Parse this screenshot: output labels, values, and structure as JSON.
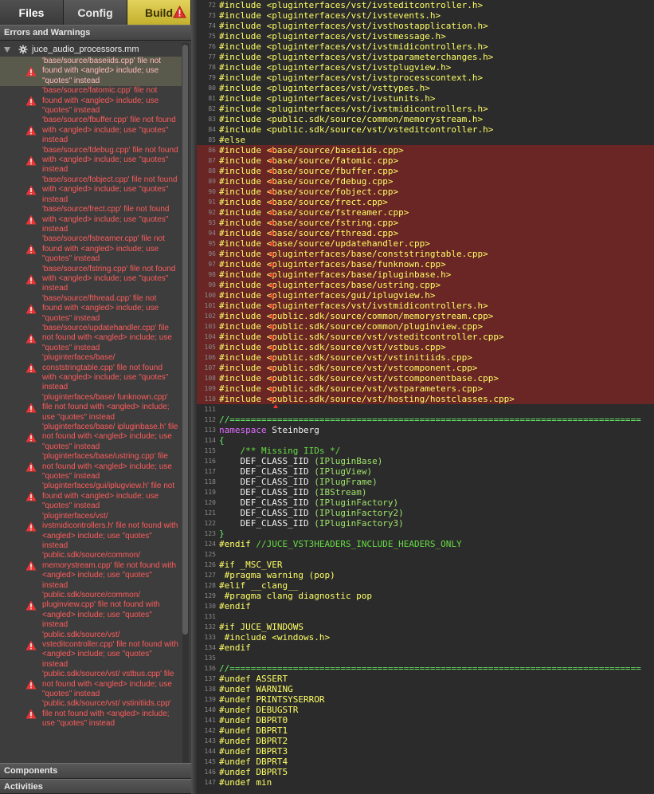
{
  "tabs": {
    "files": "Files",
    "config": "Config",
    "build": "Build"
  },
  "panel": {
    "errors_header": "Errors and Warnings",
    "project_file": "juce_audio_processors.mm",
    "components": "Components",
    "activities": "Activities"
  },
  "errors": [
    {
      "text": "'base/source/baseiids.cpp' file not found with <angled> include; use \"quotes\" instead",
      "selected": true
    },
    {
      "text": "'base/source/fatomic.cpp' file not found with <angled> include; use \"quotes\" instead"
    },
    {
      "text": "'base/source/fbuffer.cpp' file not found with <angled> include; use \"quotes\" instead"
    },
    {
      "text": "'base/source/fdebug.cpp' file not found with <angled> include; use \"quotes\" instead"
    },
    {
      "text": "'base/source/fobject.cpp' file not found with <angled> include; use \"quotes\" instead"
    },
    {
      "text": "'base/source/frect.cpp' file not found with <angled> include; use \"quotes\" instead"
    },
    {
      "text": "'base/source/fstreamer.cpp' file not found with <angled> include; use \"quotes\" instead"
    },
    {
      "text": "'base/source/fstring.cpp' file not found with <angled> include; use \"quotes\" instead"
    },
    {
      "text": "'base/source/fthread.cpp' file not found with <angled> include; use \"quotes\" instead"
    },
    {
      "text": "'base/source/updatehandler.cpp' file not found with <angled> include; use \"quotes\" instead"
    },
    {
      "text": "'pluginterfaces/base/ conststringtable.cpp' file not found with <angled> include; use \"quotes\" instead"
    },
    {
      "text": "'pluginterfaces/base/ funknown.cpp' file not found with <angled> include; use \"quotes\" instead"
    },
    {
      "text": "'pluginterfaces/base/ ipluginbase.h' file not found with <angled> include; use \"quotes\" instead"
    },
    {
      "text": "'pluginterfaces/base/ustring.cpp' file not found with <angled> include; use \"quotes\" instead"
    },
    {
      "text": "'pluginterfaces/gui/iplugview.h' file not found with <angled> include; use \"quotes\" instead"
    },
    {
      "text": "'pluginterfaces/vst/ ivstmidicontrollers.h' file not found with <angled> include; use \"quotes\" instead"
    },
    {
      "text": "'public.sdk/source/common/ memorystream.cpp' file not found with <angled> include; use \"quotes\" instead"
    },
    {
      "text": "'public.sdk/source/common/ pluginview.cpp' file not found with <angled> include; use \"quotes\" instead"
    },
    {
      "text": "'public.sdk/source/vst/ vsteditcontroller.cpp' file not found with <angled> include; use \"quotes\" instead"
    },
    {
      "text": "'public.sdk/source/vst/ vstbus.cpp' file not found with <angled> include; use \"quotes\" instead"
    },
    {
      "text": "'public.sdk/source/vst/ vstinitiids.cpp' file not found with <angled> include; use \"quotes\" instead"
    }
  ],
  "code_lines": [
    {
      "n": "72",
      "t": "#include <pluginterfaces/vst/ivsteditcontroller.h>",
      "k": "pp"
    },
    {
      "n": "73",
      "t": "#include <pluginterfaces/vst/ivstevents.h>",
      "k": "pp"
    },
    {
      "n": "74",
      "t": "#include <pluginterfaces/vst/ivsthostapplication.h>",
      "k": "pp"
    },
    {
      "n": "75",
      "t": "#include <pluginterfaces/vst/ivstmessage.h>",
      "k": "pp"
    },
    {
      "n": "76",
      "t": "#include <pluginterfaces/vst/ivstmidicontrollers.h>",
      "k": "pp"
    },
    {
      "n": "77",
      "t": "#include <pluginterfaces/vst/ivstparameterchanges.h>",
      "k": "pp"
    },
    {
      "n": "78",
      "t": "#include <pluginterfaces/vst/ivstplugview.h>",
      "k": "pp"
    },
    {
      "n": "79",
      "t": "#include <pluginterfaces/vst/ivstprocesscontext.h>",
      "k": "pp"
    },
    {
      "n": "80",
      "t": "#include <pluginterfaces/vst/vsttypes.h>",
      "k": "pp"
    },
    {
      "n": "81",
      "t": "#include <pluginterfaces/vst/ivstunits.h>",
      "k": "pp"
    },
    {
      "n": "82",
      "t": "#include <pluginterfaces/vst/ivstmidicontrollers.h>",
      "k": "pp"
    },
    {
      "n": "83",
      "t": "#include <public.sdk/source/common/memorystream.h>",
      "k": "pp"
    },
    {
      "n": "84",
      "t": "#include <public.sdk/source/vst/vsteditcontroller.h>",
      "k": "pp"
    },
    {
      "n": "85",
      "t": "#else",
      "k": "pp"
    },
    {
      "n": "86",
      "t": "#include <base/source/baseiids.cpp>",
      "k": "pp",
      "e": true
    },
    {
      "n": "87",
      "t": "#include <base/source/fatomic.cpp>",
      "k": "pp",
      "e": true
    },
    {
      "n": "88",
      "t": "#include <base/source/fbuffer.cpp>",
      "k": "pp",
      "e": true
    },
    {
      "n": "89",
      "t": "#include <base/source/fdebug.cpp>",
      "k": "pp",
      "e": true
    },
    {
      "n": "90",
      "t": "#include <base/source/fobject.cpp>",
      "k": "pp",
      "e": true
    },
    {
      "n": "91",
      "t": "#include <base/source/frect.cpp>",
      "k": "pp",
      "e": true
    },
    {
      "n": "92",
      "t": "#include <base/source/fstreamer.cpp>",
      "k": "pp",
      "e": true
    },
    {
      "n": "93",
      "t": "#include <base/source/fstring.cpp>",
      "k": "pp",
      "e": true
    },
    {
      "n": "94",
      "t": "#include <base/source/fthread.cpp>",
      "k": "pp",
      "e": true
    },
    {
      "n": "95",
      "t": "#include <base/source/updatehandler.cpp>",
      "k": "pp",
      "e": true
    },
    {
      "n": "96",
      "t": "#include <pluginterfaces/base/conststringtable.cpp>",
      "k": "pp",
      "e": true
    },
    {
      "n": "97",
      "t": "#include <pluginterfaces/base/funknown.cpp>",
      "k": "pp",
      "e": true
    },
    {
      "n": "98",
      "t": "#include <pluginterfaces/base/ipluginbase.h>",
      "k": "pp",
      "e": true
    },
    {
      "n": "99",
      "t": "#include <pluginterfaces/base/ustring.cpp>",
      "k": "pp",
      "e": true
    },
    {
      "n": "100",
      "t": "#include <pluginterfaces/gui/iplugview.h>",
      "k": "pp",
      "e": true
    },
    {
      "n": "101",
      "t": "#include <pluginterfaces/vst/ivstmidicontrollers.h>",
      "k": "pp",
      "e": true
    },
    {
      "n": "102",
      "t": "#include <public.sdk/source/common/memorystream.cpp>",
      "k": "pp",
      "e": true
    },
    {
      "n": "103",
      "t": "#include <public.sdk/source/common/pluginview.cpp>",
      "k": "pp",
      "e": true
    },
    {
      "n": "104",
      "t": "#include <public.sdk/source/vst/vsteditcontroller.cpp>",
      "k": "pp",
      "e": true
    },
    {
      "n": "105",
      "t": "#include <public.sdk/source/vst/vstbus.cpp>",
      "k": "pp",
      "e": true
    },
    {
      "n": "106",
      "t": "#include <public.sdk/source/vst/vstinitiids.cpp>",
      "k": "pp",
      "e": true
    },
    {
      "n": "107",
      "t": "#include <public.sdk/source/vst/vstcomponent.cpp>",
      "k": "pp",
      "e": true
    },
    {
      "n": "108",
      "t": "#include <public.sdk/source/vst/vstcomponentbase.cpp>",
      "k": "pp",
      "e": true
    },
    {
      "n": "109",
      "t": "#include <public.sdk/source/vst/vstparameters.cpp>",
      "k": "pp",
      "e": true
    },
    {
      "n": "110",
      "t": "#include <public.sdk/source/vst/hosting/hostclasses.cpp>",
      "k": "pp",
      "e": true
    },
    {
      "n": "111",
      "t": "",
      "k": "text"
    },
    {
      "n": "112",
      "t": "//==============================================================================",
      "k": "sep"
    },
    {
      "n": "113",
      "t": "namespace Steinberg",
      "k": "text"
    },
    {
      "n": "114",
      "t": "{",
      "k": "sep"
    },
    {
      "n": "115",
      "t": "    /** Missing IIDs */",
      "k": "comment"
    },
    {
      "n": "116",
      "t": "    DEF_CLASS_IID (IPluginBase)",
      "k": "text"
    },
    {
      "n": "117",
      "t": "    DEF_CLASS_IID (IPlugView)",
      "k": "text"
    },
    {
      "n": "118",
      "t": "    DEF_CLASS_IID (IPlugFrame)",
      "k": "text"
    },
    {
      "n": "119",
      "t": "    DEF_CLASS_IID (IBStream)",
      "k": "text"
    },
    {
      "n": "120",
      "t": "    DEF_CLASS_IID (IPluginFactory)",
      "k": "text"
    },
    {
      "n": "121",
      "t": "    DEF_CLASS_IID (IPluginFactory2)",
      "k": "text"
    },
    {
      "n": "122",
      "t": "    DEF_CLASS_IID (IPluginFactory3)",
      "k": "text"
    },
    {
      "n": "123",
      "t": "}",
      "k": "sep"
    },
    {
      "n": "124",
      "t": "#endif //JUCE_VST3HEADERS_INCLUDE_HEADERS_ONLY",
      "k": "endifc"
    },
    {
      "n": "125",
      "t": "",
      "k": "text"
    },
    {
      "n": "126",
      "t": "#if _MSC_VER",
      "k": "pp"
    },
    {
      "n": "127",
      "t": " #pragma warning (pop)",
      "k": "pp"
    },
    {
      "n": "128",
      "t": "#elif __clang__",
      "k": "pp"
    },
    {
      "n": "129",
      "t": " #pragma clang diagnostic pop",
      "k": "pp"
    },
    {
      "n": "130",
      "t": "#endif",
      "k": "pp"
    },
    {
      "n": "131",
      "t": "",
      "k": "text"
    },
    {
      "n": "132",
      "t": "#if JUCE_WINDOWS",
      "k": "pp"
    },
    {
      "n": "133",
      "t": " #include <windows.h>",
      "k": "pp"
    },
    {
      "n": "134",
      "t": "#endif",
      "k": "pp"
    },
    {
      "n": "135",
      "t": "",
      "k": "text"
    },
    {
      "n": "136",
      "t": "//==============================================================================",
      "k": "sep"
    },
    {
      "n": "137",
      "t": "#undef ASSERT",
      "k": "pp"
    },
    {
      "n": "138",
      "t": "#undef WARNING",
      "k": "pp"
    },
    {
      "n": "139",
      "t": "#undef PRINTSYSERROR",
      "k": "pp"
    },
    {
      "n": "140",
      "t": "#undef DEBUGSTR",
      "k": "pp"
    },
    {
      "n": "141",
      "t": "#undef DBPRT0",
      "k": "pp"
    },
    {
      "n": "142",
      "t": "#undef DBPRT1",
      "k": "pp"
    },
    {
      "n": "143",
      "t": "#undef DBPRT2",
      "k": "pp"
    },
    {
      "n": "144",
      "t": "#undef DBPRT3",
      "k": "pp"
    },
    {
      "n": "145",
      "t": "#undef DBPRT4",
      "k": "pp"
    },
    {
      "n": "146",
      "t": "#undef DBPRT5",
      "k": "pp"
    },
    {
      "n": "147",
      "t": "#undef min",
      "k": "pp"
    }
  ],
  "colors": {
    "error_text": "#ff5c5c",
    "error_row_bg": "#6a2525",
    "build_tab": "#d8c640",
    "preprocessor": "#ffff66",
    "comment": "#66dd44"
  }
}
